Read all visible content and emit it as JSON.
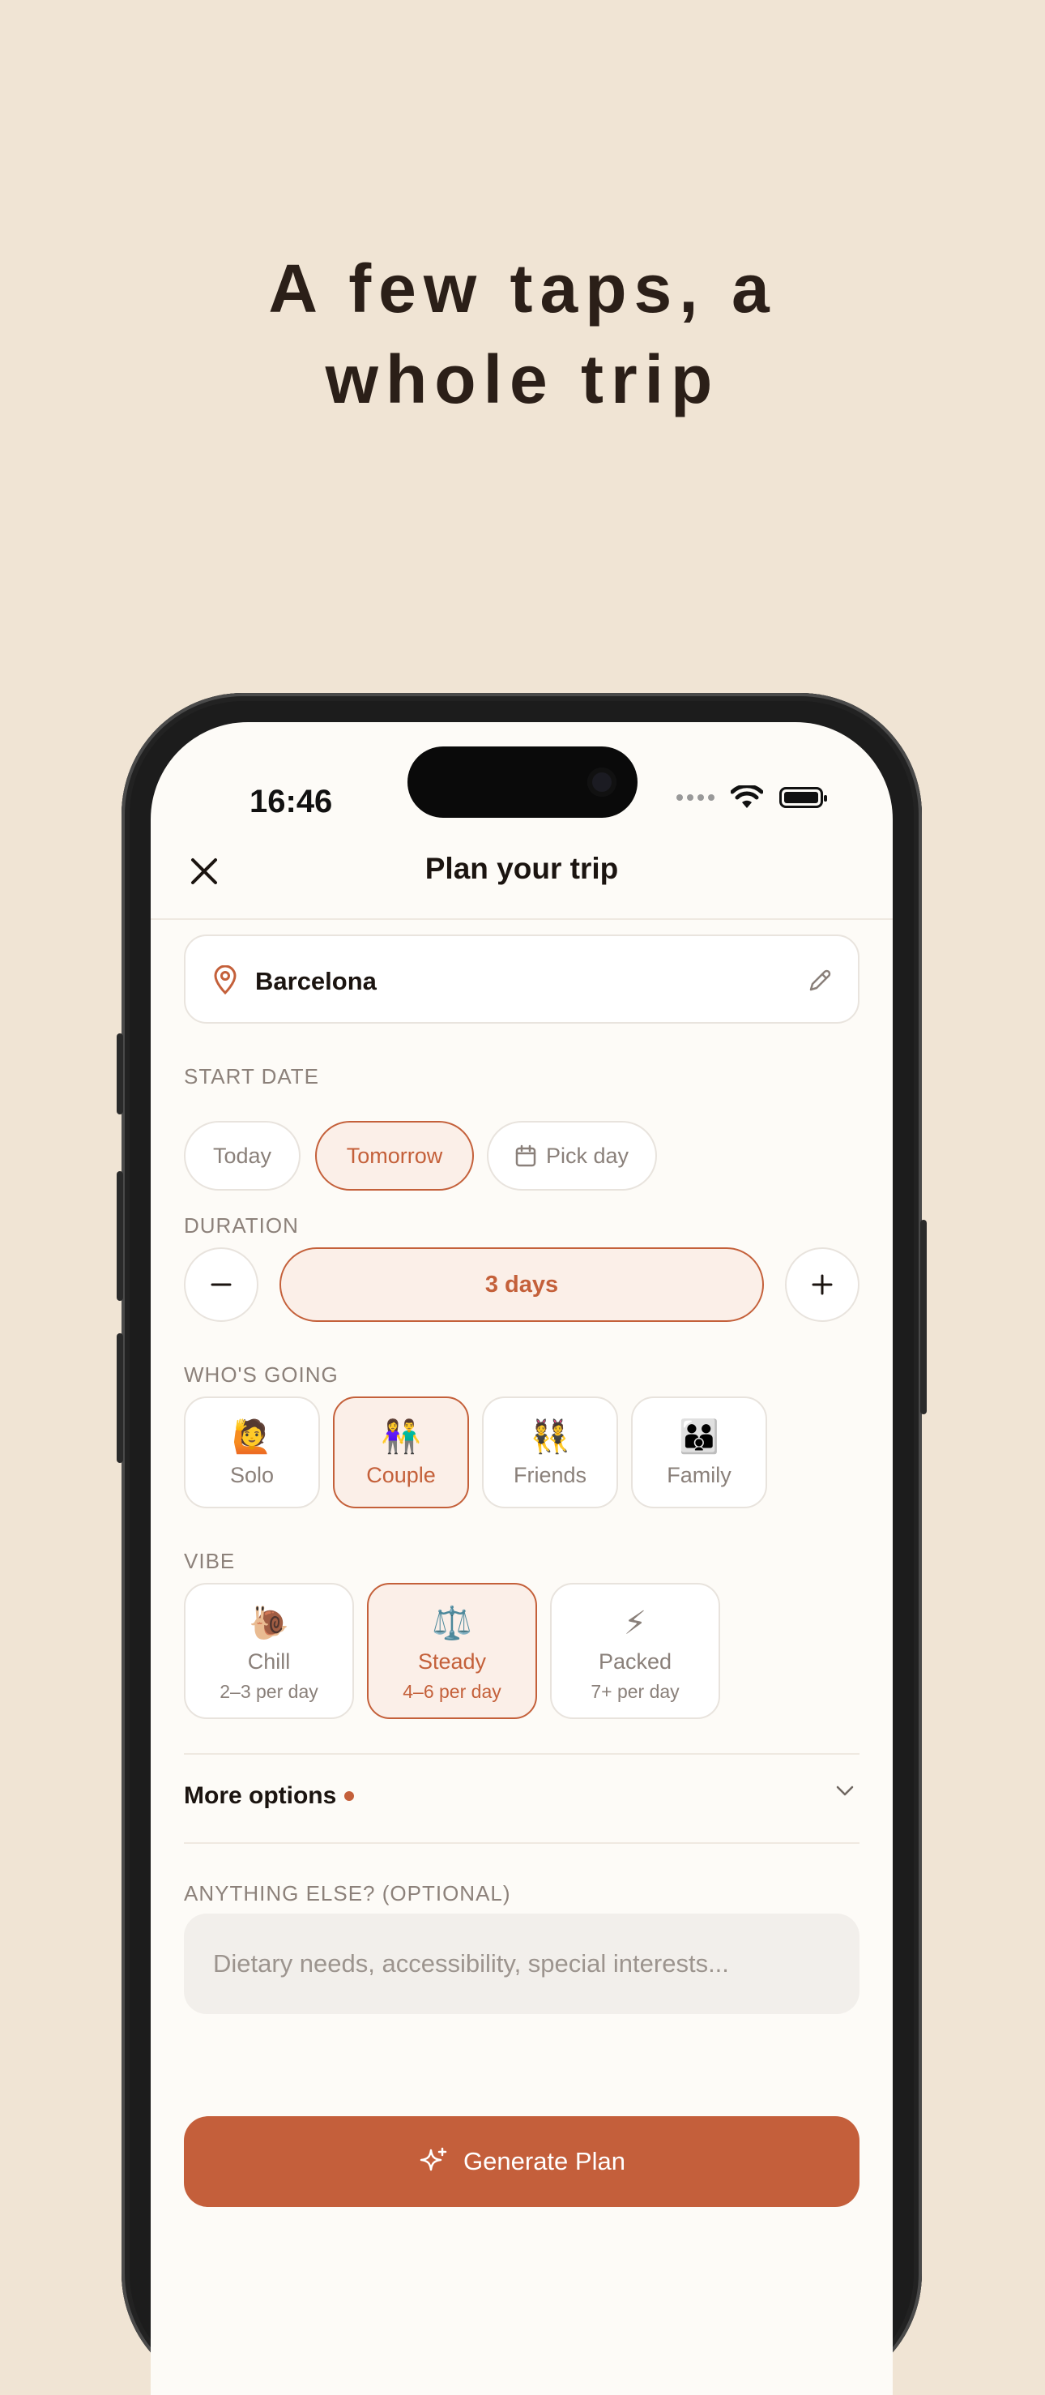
{
  "headline": {
    "line1": "A few taps, a",
    "line2": "whole trip"
  },
  "status_bar": {
    "time": "16:46"
  },
  "nav": {
    "title": "Plan your trip"
  },
  "location": {
    "city": "Barcelona"
  },
  "start_date": {
    "label": "START DATE",
    "options": [
      "Today",
      "Tomorrow",
      "Pick day"
    ],
    "selected": "Tomorrow"
  },
  "duration": {
    "label": "DURATION",
    "value": "3 days"
  },
  "whos_going": {
    "label": "WHO'S GOING",
    "options": [
      {
        "emoji": "🙋",
        "label": "Solo"
      },
      {
        "emoji": "👫",
        "label": "Couple"
      },
      {
        "emoji": "👯",
        "label": "Friends"
      },
      {
        "emoji": "👪",
        "label": "Family"
      }
    ],
    "selected": "Couple"
  },
  "vibe": {
    "label": "VIBE",
    "options": [
      {
        "emoji": "🐌",
        "label": "Chill",
        "sub": "2–3 per day"
      },
      {
        "emoji": "⚖️",
        "label": "Steady",
        "sub": "4–6 per day"
      },
      {
        "emoji": "⚡",
        "label": "Packed",
        "sub": "7+ per day"
      }
    ],
    "selected": "Steady"
  },
  "more_options": {
    "label": "More options"
  },
  "notes": {
    "label": "ANYTHING ELSE? (OPTIONAL)",
    "placeholder": "Dietary needs, accessibility, special interests..."
  },
  "generate": {
    "label": "Generate Plan"
  },
  "colors": {
    "accent": "#c45f3b",
    "background": "#f0e4d4",
    "screen": "#fdfbf7"
  }
}
